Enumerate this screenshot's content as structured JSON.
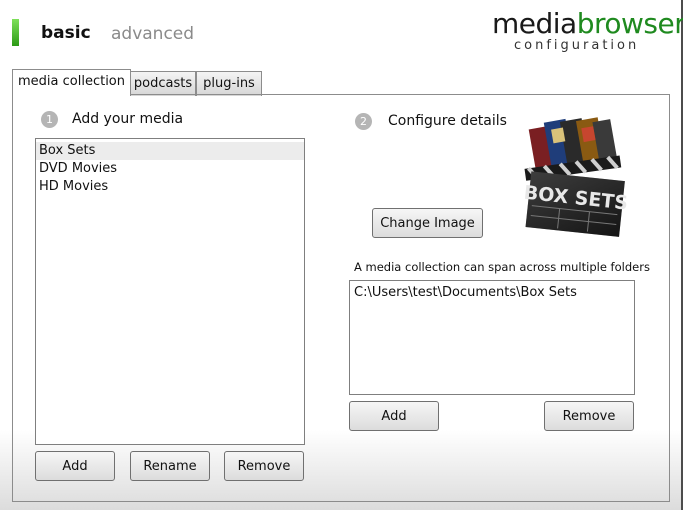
{
  "nav": {
    "basic": "basic",
    "advanced": "advanced"
  },
  "logo": {
    "word1": "media",
    "word2": "browser",
    "subtitle": "configuration"
  },
  "tabs": [
    {
      "label": "media collection"
    },
    {
      "label": "podcasts"
    },
    {
      "label": "plug-ins"
    }
  ],
  "media": {
    "step": "1",
    "title": "Add your media",
    "items": [
      "Box Sets",
      "DVD Movies",
      "HD Movies"
    ],
    "add_label": "Add",
    "rename_label": "Rename",
    "remove_label": "Remove"
  },
  "details": {
    "step": "2",
    "title": "Configure details",
    "image_text": "BOX SETS",
    "change_image_label": "Change Image",
    "info": "A media collection can span across multiple folders",
    "folders": [
      "C:\\Users\\test\\Documents\\Box Sets"
    ],
    "add_label": "Add",
    "remove_label": "Remove"
  },
  "colors": {
    "brand_green": "#1f8a1f",
    "accent_bar": "#3cb81e"
  }
}
